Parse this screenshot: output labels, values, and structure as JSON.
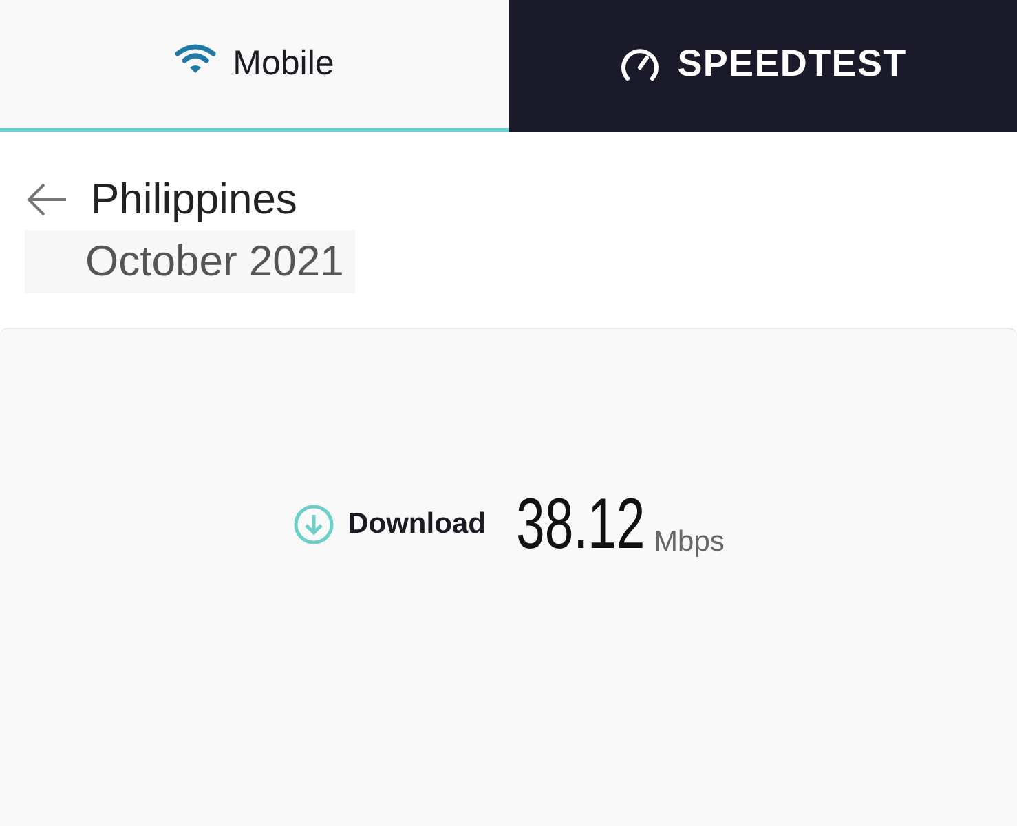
{
  "tab": {
    "label": "Mobile",
    "selected": true
  },
  "brand": {
    "label": "SPEEDTEST"
  },
  "header": {
    "country": "Philippines",
    "period": "October 2021"
  },
  "result": {
    "label": "Download",
    "value": "38.12",
    "unit": "Mbps"
  }
}
